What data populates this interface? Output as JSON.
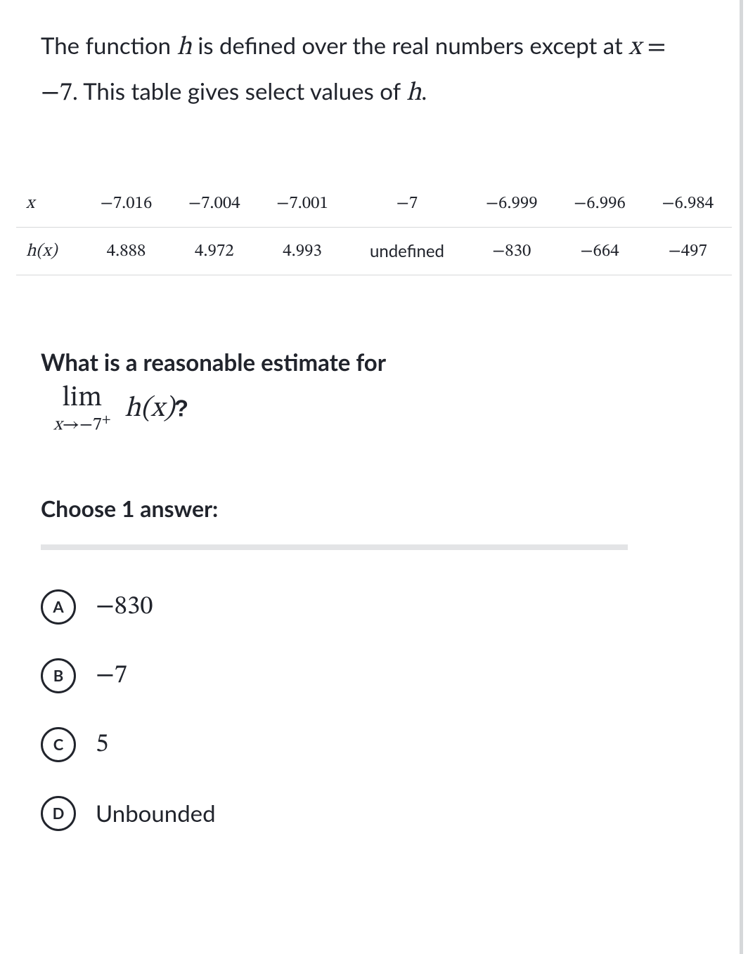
{
  "intro": {
    "part1": "The function ",
    "hvar": "h",
    "part2": " is defined over the real numbers except at ",
    "xvar": "x",
    "eq": " = ",
    "val": "−7",
    "part3": ". This table gives select values of ",
    "hvar2": "h",
    "part4": "."
  },
  "table": {
    "row1": {
      "label": "x",
      "c1": "−7.016",
      "c2": "−7.004",
      "c3": "−7.001",
      "c4": "−7",
      "c5": "−6.999",
      "c6": "−6.996",
      "c7": "−6.984"
    },
    "row2": {
      "label": "h(x)",
      "c1": "4.888",
      "c2": "4.972",
      "c3": "4.993",
      "c4": "undefined",
      "c5": "−830",
      "c6": "−664",
      "c7": "−497"
    }
  },
  "question": {
    "line1": "What is a reasonable estimate for",
    "lim": "lim",
    "sub_x": "x",
    "sub_arrow": "→",
    "sub_val": "−7",
    "sub_sup": "+",
    "hx": "h(x)",
    "qmark": "?"
  },
  "choose": "Choose 1 answer:",
  "choices": {
    "a": {
      "letter": "A",
      "text": "−830"
    },
    "b": {
      "letter": "B",
      "text": "−7"
    },
    "c": {
      "letter": "C",
      "text": "5"
    },
    "d": {
      "letter": "D",
      "text": "Unbounded"
    }
  }
}
